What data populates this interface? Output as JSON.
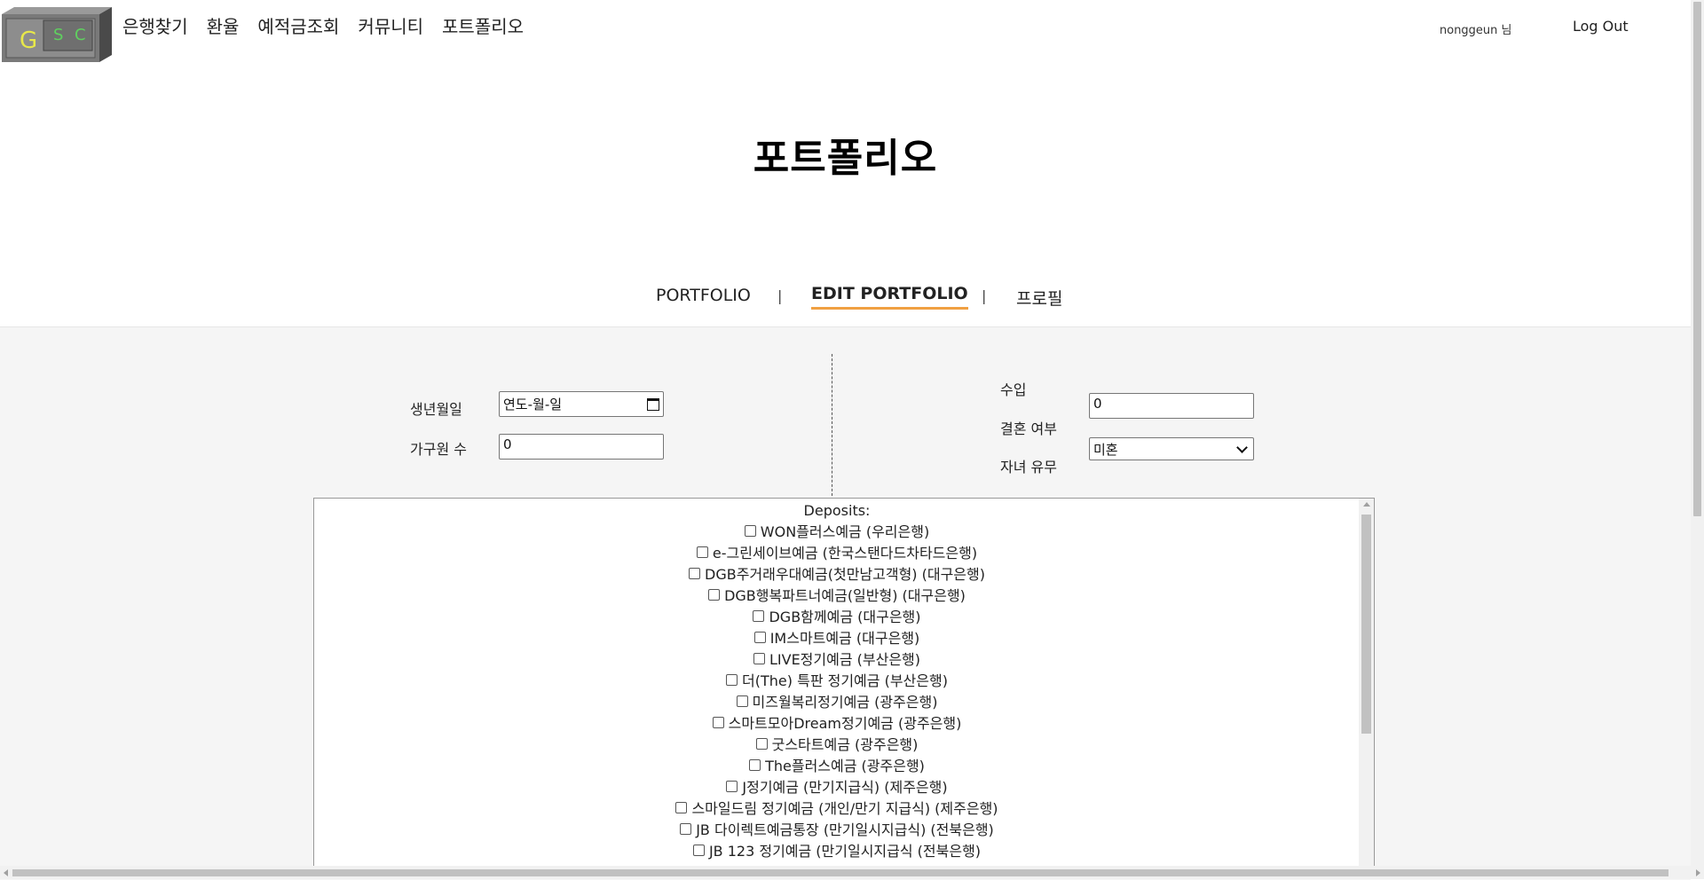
{
  "header": {
    "logo": {
      "letters": [
        "G",
        "S",
        "C"
      ],
      "icon": "vault-logo-icon"
    },
    "nav": [
      "은행찾기",
      "환율",
      "예적금조회",
      "커뮤니티",
      "포트폴리오"
    ],
    "user": "nonggeun 님",
    "logout": "Log Out"
  },
  "page_title": "포트폴리오",
  "tabs": {
    "portfolio": "PORTFOLIO",
    "separator": "|",
    "edit": "EDIT PORTFOLIO",
    "profile": "프로필",
    "active": "edit",
    "accent": "#f0a042"
  },
  "form": {
    "birth_label": "생년월일",
    "birth_value": "연도-월-일",
    "household_label": "가구원 수",
    "household_value": "0",
    "income_label": "수입",
    "income_value": "0",
    "marriage_label": "결혼 여부",
    "marriage_value": "미혼",
    "children_label": "자녀 유무"
  },
  "deposits": {
    "title": "Deposits:",
    "items": [
      "WON플러스예금 (우리은행)",
      "e-그린세이브예금 (한국스탠다드차타드은행)",
      "DGB주거래우대예금(첫만남고객형) (대구은행)",
      "DGB행복파트너예금(일반형) (대구은행)",
      "DGB함께예금 (대구은행)",
      "IM스마트예금 (대구은행)",
      "LIVE정기예금 (부산은행)",
      "더(The) 특판 정기예금 (부산은행)",
      "미즈월복리정기예금 (광주은행)",
      "스마트모아Dream정기예금 (광주은행)",
      "굿스타트예금 (광주은행)",
      "The플러스예금 (광주은행)",
      "J정기예금 (만기지급식) (제주은행)",
      "스마일드림 정기예금 (개인/만기 지급식) (제주은행)",
      "JB 다이렉트예금통장 (만기일시지급식) (전북은행)",
      "JB 123 정기예금 (만기일시지급식 (전북은행)"
    ]
  }
}
